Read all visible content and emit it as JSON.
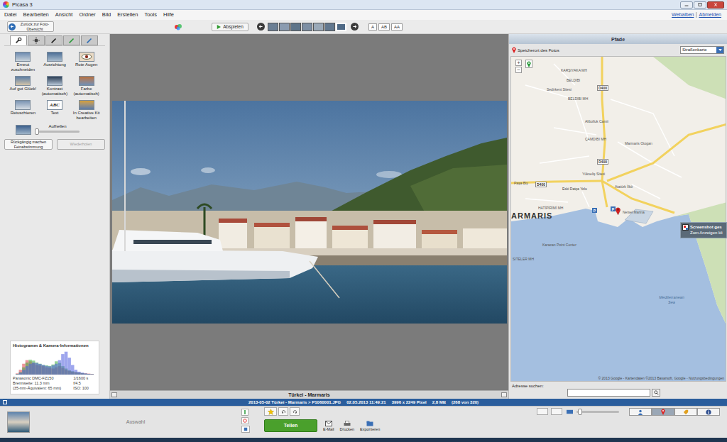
{
  "window": {
    "title": "Picasa 3"
  },
  "menu": [
    "Datei",
    "Bearbeiten",
    "Ansicht",
    "Ordner",
    "Bild",
    "Erstellen",
    "Tools",
    "Hilfe"
  ],
  "account_links": [
    "Webalben",
    "Abmelden"
  ],
  "toolbar": {
    "back": "Zurück zur Foto-Übersicht",
    "play": "Abspielen",
    "thumbnails": [
      {
        "selected": false
      },
      {
        "selected": false
      },
      {
        "selected": false
      },
      {
        "selected": false
      },
      {
        "selected": false
      },
      {
        "selected": false
      },
      {
        "selected": true
      }
    ],
    "text_size_buttons": [
      "A",
      "AB",
      "AA"
    ]
  },
  "left_panel": {
    "tabs": [
      {
        "selected": true
      },
      {
        "selected": false
      },
      {
        "selected": false
      },
      {
        "selected": false
      },
      {
        "selected": false
      }
    ],
    "tools": [
      {
        "label": "Erneut zuschneiden"
      },
      {
        "label": "Ausrichtung"
      },
      {
        "label": "Rote Augen"
      },
      {
        "label": "Auf gut Glück!"
      },
      {
        "label": "Kontrast (automatisch)"
      },
      {
        "label": "Farbe (automatisch)"
      },
      {
        "label": "Retuschieren"
      },
      {
        "label": "Text",
        "icon_text": "ABC"
      },
      {
        "label": "In Creative Kit bearbeiten"
      }
    ],
    "slider": {
      "label": "Aufhellen",
      "level": 0.03
    },
    "buttons": [
      {
        "label": "Rückgängig machen Feinabstimmung",
        "disabled": false
      },
      {
        "label": "Wiederholen",
        "disabled": true
      }
    ],
    "histogram": {
      "title": "Histogramm & Kamera-Informationen",
      "series": [
        {
          "color": "#e0404a",
          "values": [
            5,
            20,
            45,
            60,
            55,
            48,
            40,
            38,
            35,
            30,
            28,
            25,
            30,
            35,
            28,
            20,
            15,
            12,
            10,
            8,
            6,
            5,
            4,
            3
          ]
        },
        {
          "color": "#3fae3f",
          "values": [
            3,
            10,
            30,
            50,
            62,
            58,
            50,
            45,
            40,
            38,
            36,
            42,
            55,
            48,
            35,
            25,
            18,
            14,
            10,
            8,
            6,
            4,
            3,
            2
          ]
        },
        {
          "color": "#4f5fe0",
          "values": [
            2,
            8,
            20,
            35,
            45,
            50,
            48,
            44,
            40,
            36,
            34,
            38,
            45,
            60,
            85,
            95,
            70,
            40,
            20,
            12,
            8,
            5,
            3,
            2
          ]
        }
      ],
      "camera_rows": [
        [
          "Panasonic DMC-FZ150",
          "1/1600 s"
        ],
        [
          "Brennweite: 11.3 mm",
          "f/4.5"
        ],
        [
          "(35-mm-Äquivalent:  65 mm)",
          "ISO: 100"
        ]
      ]
    }
  },
  "viewer": {
    "caption": "Türkei - Marmaris"
  },
  "right_panel": {
    "title": "Pfade",
    "location_label": "Speicherort des Fotos",
    "map_type": "Straßenkarte",
    "zoom": [
      "+",
      "−"
    ],
    "labels": [
      {
        "text": "KARŞIYAKA MH",
        "kind": "district"
      },
      {
        "text": "BELDIBI",
        "kind": "district"
      },
      {
        "text": "Sedirkent Sitesi",
        "kind": "poi"
      },
      {
        "text": "BELDIBI MH",
        "kind": "district"
      },
      {
        "text": "D400",
        "kind": "road"
      },
      {
        "text": "Alibolluk Camii",
        "kind": "poi"
      },
      {
        "text": "ÇAMDIBI MH",
        "kind": "district"
      },
      {
        "text": "Marmaris Otogarı",
        "kind": "poi"
      },
      {
        "text": "D400",
        "kind": "road"
      },
      {
        "text": "Yükseliş Sitesi",
        "kind": "poi"
      },
      {
        "text": "Paşa Biy",
        "kind": "poi"
      },
      {
        "text": "D400",
        "kind": "road"
      },
      {
        "text": "Eski Datça Yolu",
        "kind": "street"
      },
      {
        "text": "Atatürk İlkö",
        "kind": "poi"
      },
      {
        "text": "HATİPİRİMİ MH",
        "kind": "district"
      },
      {
        "text": "ARMARIS",
        "kind": "town"
      },
      {
        "text": "P",
        "kind": "parking"
      },
      {
        "text": "P",
        "kind": "parking"
      },
      {
        "text": "Netsel Marina",
        "kind": "poi"
      },
      {
        "text": "Karacan Point Center",
        "kind": "poi"
      },
      {
        "text": "SITELER MH",
        "kind": "district"
      },
      {
        "text": "Mediterranean Sea",
        "kind": "water"
      }
    ],
    "copyright": "© 2013 Google - Kartendaten ©2013 Basarsoft, Google - Nutzungsbedingungen",
    "address_label": "Adresse suchen:"
  },
  "notification": {
    "title": "Screenshot ges",
    "text": "Zum Anzeigen kli"
  },
  "status_bar": [
    "2013-05-02 Türkei - Marmaris > P1060001.JPG",
    "02.05.2013 11:49:21",
    "3996 x 2249 Pixel",
    "2,8 MB",
    "(268 von 320)"
  ],
  "tray": {
    "selection_label": "Auswahl",
    "share": "Teilen",
    "actions": [
      "E-Mail",
      "Drucken",
      "Exportieren"
    ],
    "zoom_level": 0.08,
    "tabs": [
      {
        "selected": false
      },
      {
        "selected": true
      },
      {
        "selected": false
      },
      {
        "selected": false
      }
    ]
  }
}
